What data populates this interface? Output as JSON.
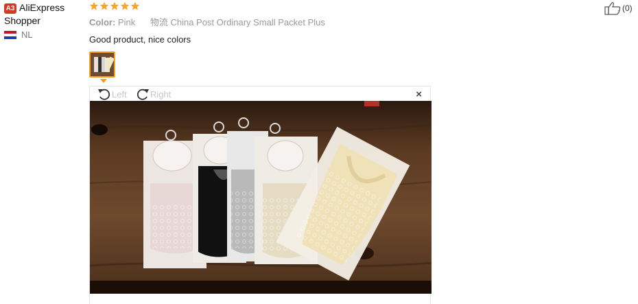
{
  "user": {
    "level_badge": "A3",
    "name_line1": "AliExpress",
    "name_line2": "Shopper",
    "country": "NL"
  },
  "review": {
    "rating": 5,
    "color_label": "Color:",
    "color_value": "Pink",
    "shipping_label": "物流",
    "shipping_value": "China Post Ordinary Small Packet Plus",
    "comment": "Good product, nice colors"
  },
  "viewer": {
    "rotate_left_label": "Left",
    "rotate_right_label": "Right",
    "close_symbol": "×"
  },
  "helpful": {
    "count": "(0)"
  },
  "colors": {
    "star": "#f5a623",
    "badge": "#d9351f",
    "thumb_border": "#f0a023"
  },
  "icons": [
    "star-icon",
    "thumbs-up-icon",
    "rotate-left-icon",
    "rotate-right-icon",
    "close-icon",
    "flag-nl-icon"
  ]
}
